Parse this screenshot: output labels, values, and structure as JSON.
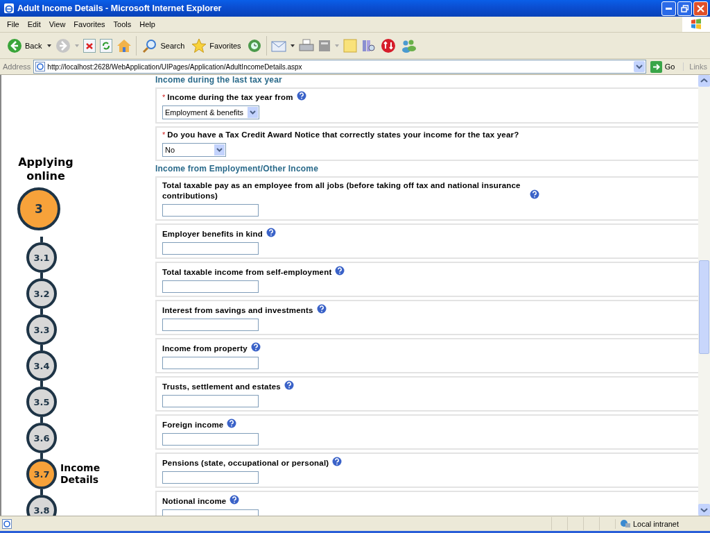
{
  "window": {
    "title": "Adult Income Details - Microsoft Internet Explorer"
  },
  "menu": [
    "File",
    "Edit",
    "View",
    "Favorites",
    "Tools",
    "Help"
  ],
  "toolbar": {
    "back": "Back",
    "search": "Search",
    "favorites": "Favorites"
  },
  "address": {
    "label": "Address",
    "url": "http://localhost:2628/WebApplication/UIPages/Application/AdultIncomeDetails.aspx",
    "go": "Go",
    "links": "Links"
  },
  "progress": {
    "heading": "Applying online",
    "main_step": {
      "label": "3",
      "current": true
    },
    "steps": [
      {
        "label": "3.1",
        "current": false
      },
      {
        "label": "3.2",
        "current": false
      },
      {
        "label": "3.3",
        "current": false
      },
      {
        "label": "3.4",
        "current": false
      },
      {
        "label": "3.5",
        "current": false
      },
      {
        "label": "3.6",
        "current": false
      },
      {
        "label": "3.7",
        "current": true,
        "caption": "Income Details"
      },
      {
        "label": "3.8",
        "current": false
      }
    ]
  },
  "sections": [
    {
      "heading": "Income during the last tax year",
      "items": [
        {
          "kind": "select",
          "required_mark": "*",
          "label": "Income during the tax year from",
          "help": true,
          "value": "Employment & benefits"
        },
        {
          "kind": "select",
          "required_mark": "*",
          "label": "Do you have a Tax Credit Award Notice that correctly states your income for the tax year?",
          "help": false,
          "value": "No"
        }
      ]
    },
    {
      "heading": "Income from Employment/Other Income",
      "items": [
        {
          "kind": "text",
          "label": "Total taxable pay as an employee from all jobs (before taking off tax and national insurance contributions)",
          "help": true
        },
        {
          "kind": "text",
          "label": "Employer benefits in kind",
          "help": true
        },
        {
          "kind": "text",
          "label": "Total taxable income from self-employment",
          "help": true
        },
        {
          "kind": "text",
          "label": "Interest from savings and investments",
          "help": true
        },
        {
          "kind": "text",
          "label": "Income from property",
          "help": true
        },
        {
          "kind": "text",
          "label": "Trusts, settlement and estates",
          "help": true
        },
        {
          "kind": "text",
          "label": "Foreign income",
          "help": true
        },
        {
          "kind": "text",
          "label": "Pensions (state, occupational or personal)",
          "help": true
        },
        {
          "kind": "text",
          "label": "Notional income",
          "help": true
        }
      ]
    }
  ],
  "status_bar": {
    "zone": "Local intranet"
  }
}
